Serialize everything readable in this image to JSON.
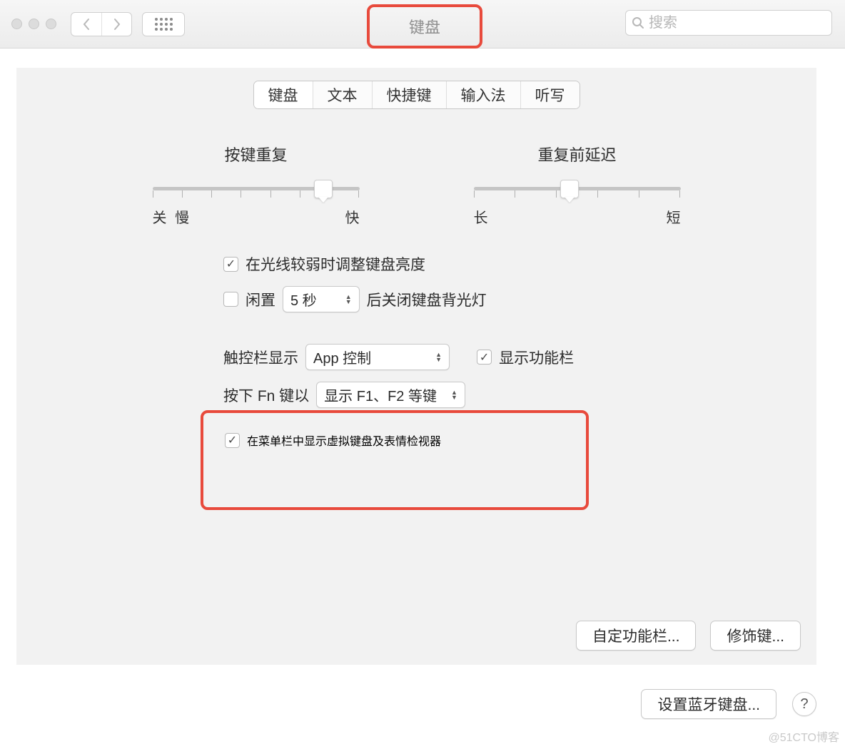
{
  "window": {
    "title": "键盘",
    "search_placeholder": "搜索"
  },
  "tabs": [
    "键盘",
    "文本",
    "快捷键",
    "输入法",
    "听写"
  ],
  "active_tab_index": 0,
  "slider_repeat": {
    "title": "按键重复",
    "left1": "关",
    "left2": "慢",
    "right": "快",
    "value": 0.78
  },
  "slider_delay": {
    "title": "重复前延迟",
    "left": "长",
    "right": "短",
    "value": 0.42
  },
  "options": {
    "adjust_brightness": {
      "checked": true,
      "label": "在光线较弱时调整键盘亮度"
    },
    "idle": {
      "checked": false,
      "label_prefix": "闲置",
      "select_value": "5 秒",
      "label_suffix": "后关闭键盘背光灯"
    },
    "touchbar": {
      "label": "触控栏显示",
      "select_value": "App 控制",
      "show_fn_checked": true,
      "show_fn_label": "显示功能栏"
    },
    "fnkey": {
      "label": "按下 Fn 键以",
      "select_value": "显示 F1、F2 等键"
    },
    "menubar_viewer": {
      "checked": true,
      "label": "在菜单栏中显示虚拟键盘及表情检视器"
    }
  },
  "buttons": {
    "customize_touchbar": "自定功能栏...",
    "modifier_keys": "修饰键...",
    "bluetooth_keyboard": "设置蓝牙键盘...",
    "help": "?"
  },
  "watermark": "@51CTO博客"
}
